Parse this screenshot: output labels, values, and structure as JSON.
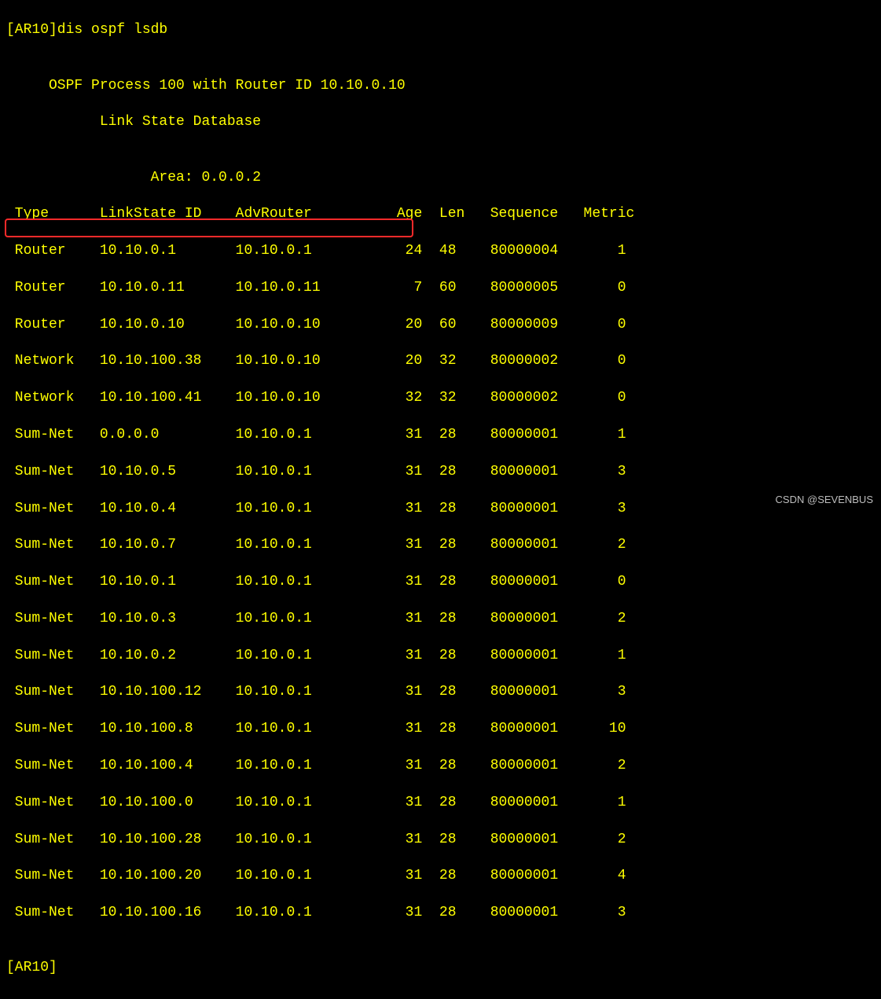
{
  "prompt": "[AR10]dis ospf lsdb",
  "blank1": "",
  "header1": "     OSPF Process 100 with Router ID 10.10.0.10",
  "header2": "           Link State Database",
  "blank2": "",
  "area_line": "                 Area: 0.0.0.2",
  "columns": " Type      LinkState ID    AdvRouter          Age  Len   Sequence   Metric",
  "rows": [
    " Router    10.10.0.1       10.10.0.1           24  48    80000004       1",
    " Router    10.10.0.11      10.10.0.11           7  60    80000005       0",
    " Router    10.10.0.10      10.10.0.10          20  60    80000009       0",
    " Network   10.10.100.38    10.10.0.10          20  32    80000002       0",
    " Network   10.10.100.41    10.10.0.10          32  32    80000002       0",
    " Sum-Net   0.0.0.0         10.10.0.1           31  28    80000001       1",
    " Sum-Net   10.10.0.5       10.10.0.1           31  28    80000001       3",
    " Sum-Net   10.10.0.4       10.10.0.1           31  28    80000001       3",
    " Sum-Net   10.10.0.7       10.10.0.1           31  28    80000001       2",
    " Sum-Net   10.10.0.1       10.10.0.1           31  28    80000001       0",
    " Sum-Net   10.10.0.3       10.10.0.1           31  28    80000001       2",
    " Sum-Net   10.10.0.2       10.10.0.1           31  28    80000001       1",
    " Sum-Net   10.10.100.12    10.10.0.1           31  28    80000001       3",
    " Sum-Net   10.10.100.8     10.10.0.1           31  28    80000001      10",
    " Sum-Net   10.10.100.4     10.10.0.1           31  28    80000001       2",
    " Sum-Net   10.10.100.0     10.10.0.1           31  28    80000001       1",
    " Sum-Net   10.10.100.28    10.10.0.1           31  28    80000001       2",
    " Sum-Net   10.10.100.20    10.10.0.1           31  28    80000001       4",
    " Sum-Net   10.10.100.16    10.10.0.1           31  28    80000001       3"
  ],
  "blank3": "",
  "end_prompt": "[AR10]",
  "watermark": "CSDN @SEVENBUS"
}
